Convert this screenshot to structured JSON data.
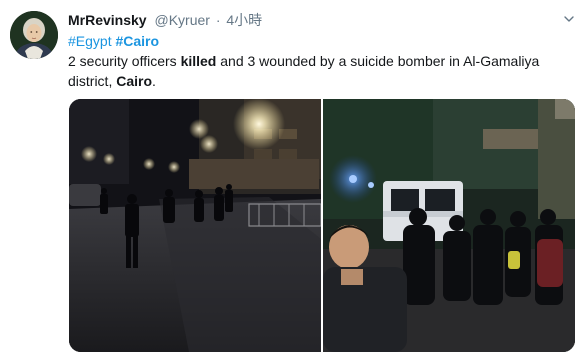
{
  "tweet": {
    "display_name": "MrRevinsky",
    "handle": "@Kyruer",
    "dot": "·",
    "timestamp": "4小時",
    "hashtags": [
      "#Egypt",
      "#Cairo"
    ],
    "text": {
      "part1": "2 security officers ",
      "killed": "killed",
      "part2": " and 3 wounded by a suicide bomber in Al-Gamaliya district, ",
      "cairo": "Cairo",
      "part3": "."
    }
  },
  "icons": {
    "avatar": "avatar-portrait",
    "menu": "chevron-down-icon"
  },
  "colors": {
    "link": "#1b95e0",
    "text": "#14171a",
    "secondary": "#657786"
  }
}
